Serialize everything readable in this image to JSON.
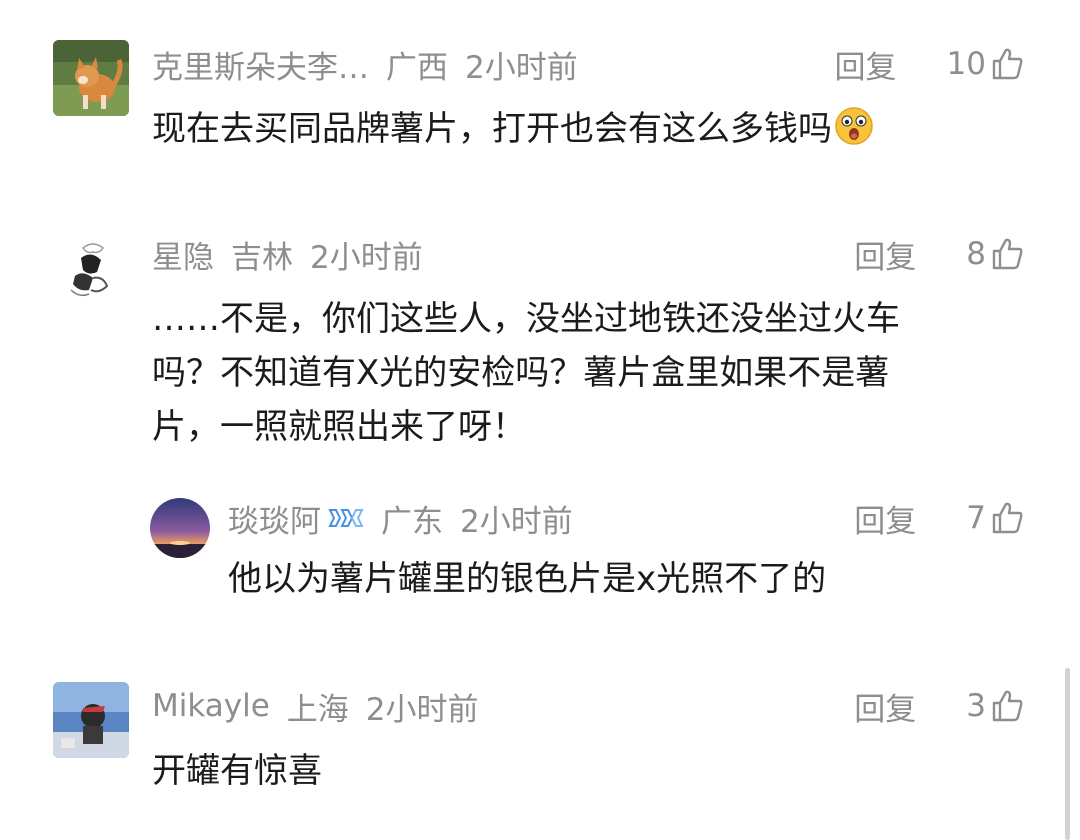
{
  "comments": [
    {
      "author": "克里斯朵夫李…",
      "location": "广西",
      "time": "2小时前",
      "reply_label": "回复",
      "likes": "10",
      "text": "现在去买同品牌薯片，打开也会有这么多钱吗",
      "emoji": "surprised-face-icon",
      "avatar": "cat-avatar"
    },
    {
      "author": "星隐",
      "location": "吉林",
      "time": "2小时前",
      "reply_label": "回复",
      "likes": "8",
      "lines": [
        "……不是，你们这些人，没坐过地铁还没坐过火车",
        "吗？不知道有X光的安检吗？薯片盒里如果不是薯",
        "片，一照就照出来了呀！"
      ],
      "avatar": "sketch-avatar",
      "replies": [
        {
          "author": "琰琰阿",
          "badge": "vip-badge-icon",
          "location": "广东",
          "time": "2小时前",
          "reply_label": "回复",
          "likes": "7",
          "text": "他以为薯片罐里的银色片是x光照不了的",
          "avatar": "sunset-avatar"
        }
      ]
    },
    {
      "author": "Mikayle",
      "location": "上海",
      "time": "2小时前",
      "reply_label": "回复",
      "likes": "3",
      "text": "开罐有惊喜",
      "avatar": "photo-avatar"
    }
  ],
  "colors": {
    "meta": "#8e8e8e",
    "text": "#1b1b1b",
    "badge": "#4a90e2"
  }
}
